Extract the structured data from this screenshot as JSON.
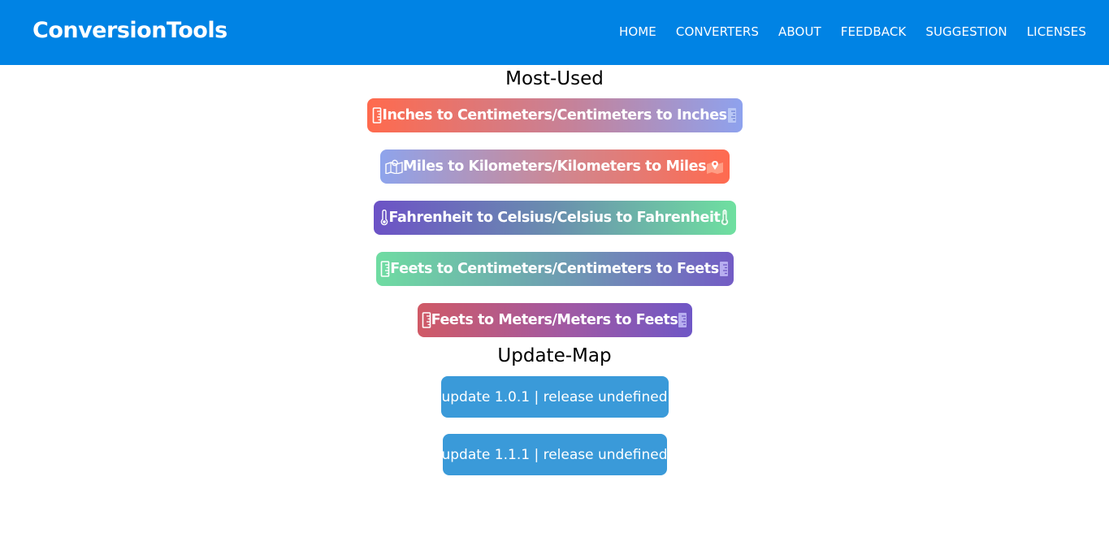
{
  "header": {
    "brand": "ConversionTools",
    "nav": [
      "HOME",
      "CONVERTERS",
      "ABOUT",
      "FEEDBACK",
      "SUGGESTION",
      "LICENSES"
    ],
    "background_color": "#0083e4"
  },
  "most_used": {
    "title": "Most-Used",
    "items": [
      {
        "label": "Inches to Centimeters/Centimeters to Inches",
        "icon_left": "ruler-icon",
        "icon_right": "ruler-icon"
      },
      {
        "label": "Miles to Kilometers/Kilometers to Miles",
        "icon_left": "map-icon",
        "icon_right": "map-pin-icon"
      },
      {
        "label": "Fahrenheit to Celsius/Celsius to Fahrenheit",
        "icon_left": "thermometer-icon",
        "icon_right": "thermometer-icon"
      },
      {
        "label": "Feets to Centimeters/Centimeters to Feets",
        "icon_left": "ruler-icon",
        "icon_right": "ruler-icon"
      },
      {
        "label": "Feets to Meters/Meters to Feets",
        "icon_left": "ruler-icon",
        "icon_right": "ruler-icon"
      }
    ]
  },
  "update_map": {
    "title": "Update-Map",
    "items": [
      {
        "label": "update 1.0.1 | release undefined"
      },
      {
        "label": "update 1.1.1 | release undefined"
      }
    ],
    "button_color": "#3a9ad9"
  }
}
